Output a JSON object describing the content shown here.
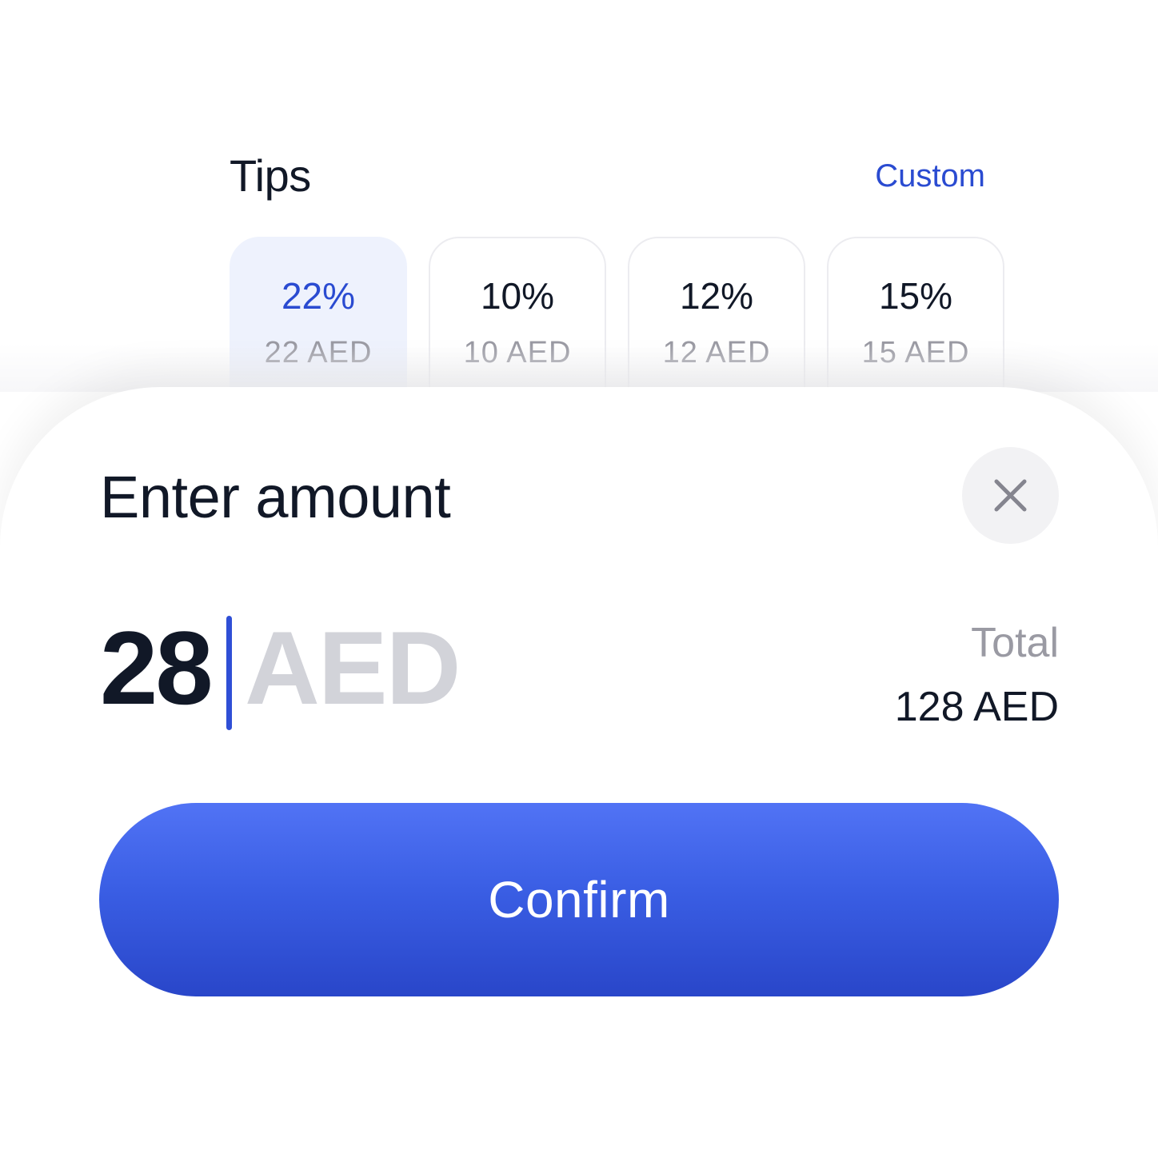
{
  "tips": {
    "title": "Tips",
    "custom_label": "Custom",
    "options": [
      {
        "percent": "22%",
        "amount": "22 AED",
        "selected": true
      },
      {
        "percent": "10%",
        "amount": "10 AED",
        "selected": false
      },
      {
        "percent": "12%",
        "amount": "12 AED",
        "selected": false
      },
      {
        "percent": "15%",
        "amount": "15 AED",
        "selected": false
      }
    ]
  },
  "sheet": {
    "title": "Enter amount",
    "close_icon": "close-icon",
    "amount_value": "28",
    "amount_currency": "AED",
    "total_label": "Total",
    "total_value": "128 AED",
    "confirm_label": "Confirm"
  },
  "colors": {
    "accent": "#2a4bd1",
    "button_top": "#5173f5",
    "button_bottom": "#2946c9",
    "text_primary": "#111827",
    "text_muted": "#9a9aa3",
    "selected_card_bg": "#eef2fd"
  }
}
